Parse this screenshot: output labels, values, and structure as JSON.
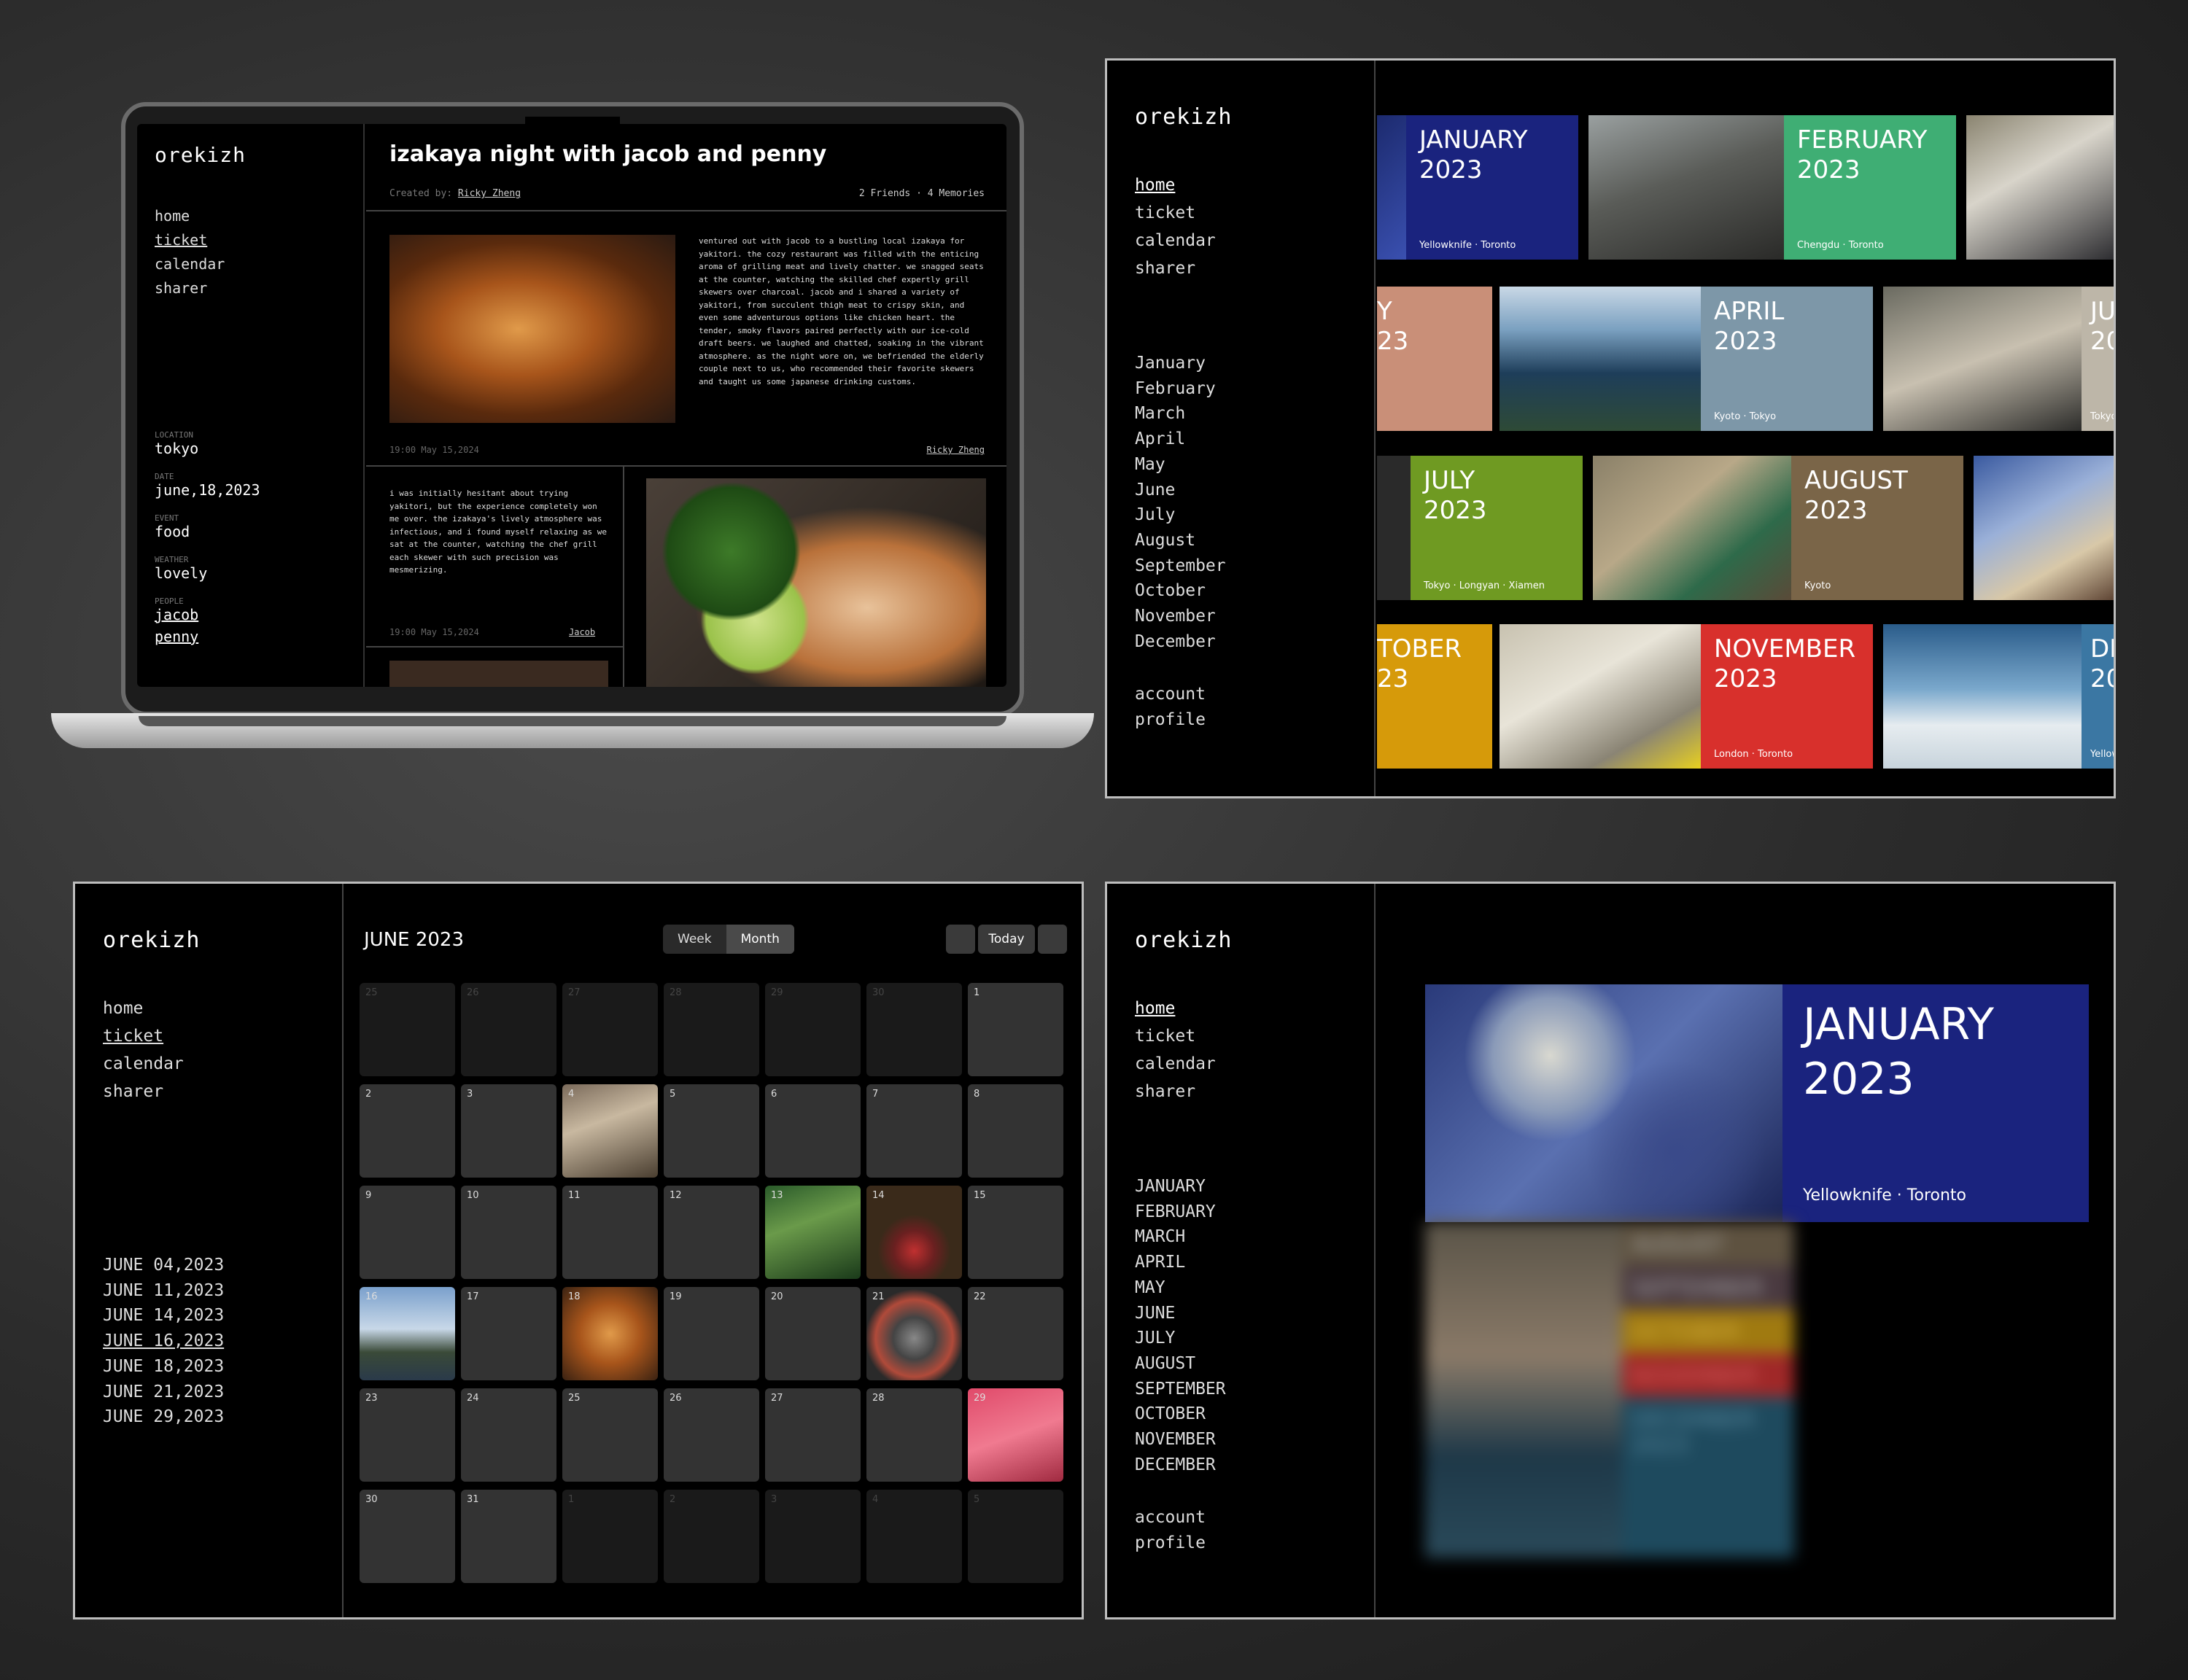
{
  "brand": "orekizh",
  "nav": {
    "home": "home",
    "ticket": "ticket",
    "calendar": "calendar",
    "sharer": "sharer",
    "account": "account",
    "profile": "profile"
  },
  "memory": {
    "title": "izakaya night with jacob and penny",
    "created_label": "Created by:",
    "created_by": "Ricky Zheng",
    "stats": "2 Friends · 4 Memories",
    "meta": [
      {
        "label": "LOCATION",
        "value": "tokyo"
      },
      {
        "label": "DATE",
        "value": "june,18,2023"
      },
      {
        "label": "EVENT",
        "value": "food"
      },
      {
        "label": "WEATHER",
        "value": "lovely"
      }
    ],
    "people_label": "PEOPLE",
    "people": [
      "jacob",
      "penny"
    ],
    "entries": [
      {
        "text": "ventured out with jacob to a bustling local izakaya for yakitori. the cozy restaurant was filled with the enticing aroma of grilling meat and lively chatter. we snagged seats at the counter, watching the skilled chef expertly grill skewers over charcoal. jacob and i shared a variety of yakitori, from succulent thigh meat to crispy skin, and even some adventurous options like chicken heart. the tender, smoky flavors paired perfectly with our ice-cold draft beers. we laughed and chatted, soaking in the vibrant atmosphere. as the night wore on, we befriended the elderly couple next to us, who recommended their favorite skewers and taught us some japanese drinking customs.",
        "time": "19:00 May 15,2024",
        "author": "Ricky Zheng"
      },
      {
        "text": "i was initially hesitant about trying yakitori, but the experience completely won me over. the izakaya's lively atmosphere was infectious, and i found myself relaxing as we sat at the counter, watching the chef grill each skewer with such precision was mesmerizing.",
        "time": "19:00 May 15,2024",
        "author": "Jacob"
      }
    ]
  },
  "months": [
    "January",
    "February",
    "March",
    "April",
    "May",
    "June",
    "July",
    "August",
    "September",
    "October",
    "November",
    "December"
  ],
  "months_upper": [
    "JANUARY",
    "FEBRUARY",
    "MARCH",
    "APRIL",
    "MAY",
    "JUNE",
    "JULY",
    "AUGUST",
    "SEPTEMBER",
    "OCTOBER",
    "NOVEMBER",
    "DECEMBER"
  ],
  "cards": {
    "jan": {
      "title": "JANUARY\n2023",
      "sub": "Yellowknife · Toronto",
      "color": "#1a237e"
    },
    "feb": {
      "title": "FEBRUARY\n2023",
      "sub": "Chengdu · Toronto",
      "color": "#3fae74"
    },
    "mar": {
      "title": "Y\n23",
      "color": "#c98f78"
    },
    "apr": {
      "title": "APRIL\n2023",
      "sub": "Kyoto · Tokyo",
      "color": "#7d97a8"
    },
    "jun": {
      "title": "JU\n20",
      "sub": "Tokyo",
      "color": "#bdb6a8"
    },
    "jul": {
      "title": "JULY\n2023",
      "sub": "Tokyo · Longyan · Xiamen",
      "color": "#6f9a22"
    },
    "aug": {
      "title": "AUGUST\n2023",
      "sub": "Kyoto",
      "color": "#7a6548"
    },
    "oct": {
      "title": "TOBER\n23",
      "color": "#d69a0a"
    },
    "nov": {
      "title": "NOVEMBER\n2023",
      "sub": "London · Toronto",
      "color": "#d8302c"
    },
    "dec": {
      "title": "DE\n20",
      "sub": "Yellow",
      "color": "#3b77a3"
    }
  },
  "calendar": {
    "title": "JUNE 2023",
    "view_week": "Week",
    "view_month": "Month",
    "today": "Today",
    "dates": [
      "JUNE 04,2023",
      "JUNE 11,2023",
      "JUNE 14,2023",
      "JUNE 16,2023",
      "JUNE 18,2023",
      "JUNE 21,2023",
      "JUNE 29,2023"
    ],
    "days": [
      "25",
      "26",
      "27",
      "28",
      "29",
      "30",
      "1",
      "2",
      "3",
      "4",
      "5",
      "6",
      "7",
      "8",
      "9",
      "10",
      "11",
      "12",
      "13",
      "14",
      "15",
      "16",
      "17",
      "18",
      "19",
      "20",
      "21",
      "22",
      "23",
      "24",
      "25",
      "26",
      "27",
      "28",
      "29",
      "30",
      "31",
      "1",
      "2",
      "3",
      "4",
      "5"
    ]
  },
  "featured": {
    "title": "JANUARY\n2023",
    "sub": "Yellowknife · Toronto",
    "blur_labels": [
      "AUGUST",
      "SEPTEMBER",
      "OCTOBER",
      "NOVEMBER",
      "DECEMBER\n2023"
    ]
  }
}
